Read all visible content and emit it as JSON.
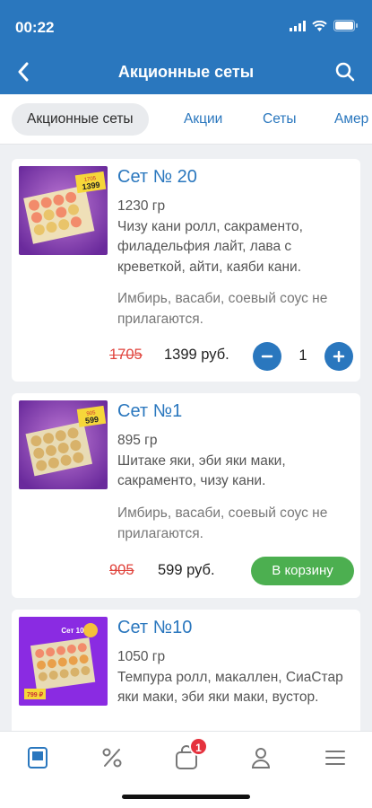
{
  "status": {
    "time": "00:22"
  },
  "header": {
    "title": "Акционные сеты"
  },
  "tabs": [
    {
      "label": "Акционные сеты"
    },
    {
      "label": "Акции"
    },
    {
      "label": "Сеты"
    },
    {
      "label": "Амер"
    }
  ],
  "products": [
    {
      "title": "Сет № 20",
      "desc": "1230 гр\nЧизу кани ролл, сакраменто, филадельфия лайт, лава с креветкой, айти, каяби кани.",
      "note": "Имбирь, васаби, соевый соус не прилагаются.",
      "old_price": "1705",
      "price": "1399 руб.",
      "qty": "1",
      "badge_price": "1399",
      "badge_old": "1705"
    },
    {
      "title": "Сет №1",
      "desc": "895 гр\nШитаке яки, эби яки маки, сакраменто, чизу кани.",
      "note": "Имбирь, васаби, соевый соус не прилагаются.",
      "old_price": "905",
      "price": "599 руб.",
      "button": "В корзину",
      "badge_price": "599",
      "badge_old": "905"
    },
    {
      "title": "Сет №10",
      "desc": "1050 гр\nТемпура ролл, макаллен, СиаСтар яки маки, эби яки маки, вустор.",
      "badge_price": "799 ₽",
      "badge_label": "Сет 10"
    }
  ],
  "bottom_nav": {
    "cart_badge": "1"
  },
  "colors": {
    "primary": "#2a77be",
    "accent_red": "#e0433c",
    "cart_green": "#4caf50"
  }
}
